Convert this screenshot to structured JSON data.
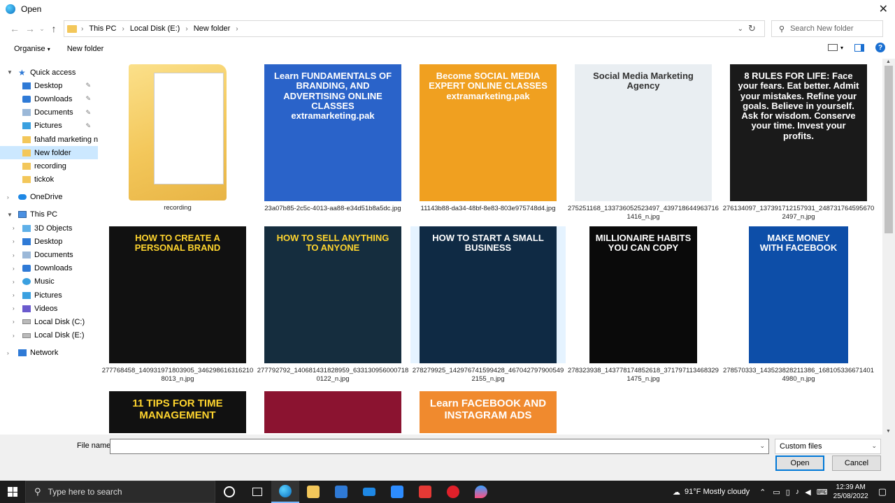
{
  "window": {
    "title": "Open"
  },
  "address": {
    "crumbs": [
      "This PC",
      "Local Disk (E:)",
      "New folder"
    ],
    "search_placeholder": "Search New folder"
  },
  "toolbar": {
    "organise": "Organise",
    "new_folder": "New folder"
  },
  "sidebar": {
    "items": [
      {
        "label": "Quick access",
        "icon": "star-icon",
        "indent": 0,
        "expanded": true
      },
      {
        "label": "Desktop",
        "icon": "desktop-icon",
        "indent": 1,
        "pinned": true
      },
      {
        "label": "Downloads",
        "icon": "downloads-icon",
        "indent": 1,
        "pinned": true
      },
      {
        "label": "Documents",
        "icon": "documents-icon",
        "indent": 1,
        "pinned": true
      },
      {
        "label": "Pictures",
        "icon": "pictures-icon",
        "indent": 1,
        "pinned": true
      },
      {
        "label": "fahafd marketing n",
        "icon": "folder-icon",
        "indent": 1
      },
      {
        "label": "New folder",
        "icon": "folder-icon",
        "indent": 1,
        "selected": true
      },
      {
        "label": "recording",
        "icon": "folder-icon",
        "indent": 1
      },
      {
        "label": "tickok",
        "icon": "folder-icon",
        "indent": 1
      },
      {
        "label": "",
        "spacer": true
      },
      {
        "label": "OneDrive",
        "icon": "onedrive-icon",
        "indent": 0,
        "collapsed": true
      },
      {
        "label": "",
        "spacer": true
      },
      {
        "label": "This PC",
        "icon": "pc-icon",
        "indent": 0,
        "expanded": true
      },
      {
        "label": "3D Objects",
        "icon": "3d-objects-icon",
        "indent": 1,
        "collapsed": true
      },
      {
        "label": "Desktop",
        "icon": "desktop-icon",
        "indent": 1,
        "collapsed": true
      },
      {
        "label": "Documents",
        "icon": "documents-icon",
        "indent": 1,
        "collapsed": true
      },
      {
        "label": "Downloads",
        "icon": "downloads-icon",
        "indent": 1,
        "collapsed": true
      },
      {
        "label": "Music",
        "icon": "music-icon",
        "indent": 1,
        "collapsed": true
      },
      {
        "label": "Pictures",
        "icon": "pictures-icon",
        "indent": 1,
        "collapsed": true
      },
      {
        "label": "Videos",
        "icon": "videos-icon",
        "indent": 1,
        "collapsed": true
      },
      {
        "label": "Local Disk (C:)",
        "icon": "disk-icon",
        "indent": 1,
        "collapsed": true
      },
      {
        "label": "Local Disk (E:)",
        "icon": "disk-icon",
        "indent": 1,
        "collapsed": true
      },
      {
        "label": "",
        "spacer": true
      },
      {
        "label": "Network",
        "icon": "network-icon",
        "indent": 0,
        "collapsed": true
      }
    ]
  },
  "files": [
    {
      "name": "recording",
      "kind": "folder",
      "thumb_text": "",
      "bg": "#f3c75a",
      "fg": "#000"
    },
    {
      "name": "23a07b85-2c5c-4013-aa88-e34d51b8a5dc.jpg",
      "kind": "image",
      "thumb_text": "Learn FUNDAMENTALS OF BRANDING, AND ADVERTISING ONLINE CLASSES extramarketing.pak",
      "bg": "#2a63c9",
      "fg": "#ffffff"
    },
    {
      "name": "11143b88-da34-48bf-8e83-803e975748d4.jpg",
      "kind": "image",
      "thumb_text": "Become SOCIAL MEDIA EXPERT ONLINE CLASSES extramarketing.pak",
      "bg": "#f0a020",
      "fg": "#ffffff"
    },
    {
      "name": "275251168_133736052523497_4397186449637161416_n.jpg",
      "kind": "image",
      "thumb_text": "Social Media Marketing Agency",
      "bg": "#e9eef2",
      "fg": "#333333"
    },
    {
      "name": "276134097_137391712157931_2487317645956702497_n.jpg",
      "kind": "image",
      "thumb_text": "8 RULES FOR LIFE: Face your fears. Eat better. Admit your mistakes. Refine your goals. Believe in yourself. Ask for wisdom. Conserve your time. Invest your profits.",
      "bg": "#1a1a1a",
      "fg": "#ffffff"
    },
    {
      "name": "277768458_140931971803905_3462986163162108013_n.jpg",
      "kind": "image",
      "thumb_text": "HOW TO CREATE A PERSONAL BRAND",
      "bg": "#111111",
      "fg": "#ffd52e"
    },
    {
      "name": "277792792_140681431828959_6331309560007180122_n.jpg",
      "kind": "image",
      "thumb_text": "HOW TO SELL ANYTHING TO ANYONE",
      "bg": "#152d3e",
      "fg": "#ffd52e"
    },
    {
      "name": "278279925_142976741599428_4670427979005492155_n.jpg",
      "kind": "image",
      "thumb_text": "HOW TO START A SMALL BUSINESS",
      "bg": "#0f2a44",
      "fg": "#ffffff"
    },
    {
      "name": "278323938_143778174852618_3717971134683291475_n.jpg",
      "kind": "image",
      "thumb_text": "MILLIONAIRE HABITS YOU CAN COPY",
      "bg": "#0a0a0a",
      "fg": "#ffffff"
    },
    {
      "name": "278570333_143523828211386_1681053366714014980_n.jpg",
      "kind": "image",
      "thumb_text": "MAKE MONEY WITH FACEBOOK",
      "bg": "#0d4ea8",
      "fg": "#ffffff"
    },
    {
      "name": "",
      "kind": "image",
      "thumb_text": "11 TIPS FOR TIME MANAGEMENT",
      "bg": "#111111",
      "fg": "#ffd52e"
    },
    {
      "name": "",
      "kind": "image",
      "thumb_text": "",
      "bg": "#8b1330",
      "fg": "#ffffff"
    },
    {
      "name": "",
      "kind": "image",
      "thumb_text": "Learn FACEBOOK AND INSTAGRAM ADS",
      "bg": "#f08a2e",
      "fg": "#ffffff"
    }
  ],
  "bottom": {
    "file_name_label": "File name:",
    "file_name_value": "",
    "file_type": "Custom files",
    "open_label": "Open",
    "cancel_label": "Cancel"
  },
  "taskbar": {
    "search_placeholder": "Type here to search",
    "weather": "91°F  Mostly cloudy",
    "time": "12:39 AM",
    "date": "25/08/2022"
  }
}
